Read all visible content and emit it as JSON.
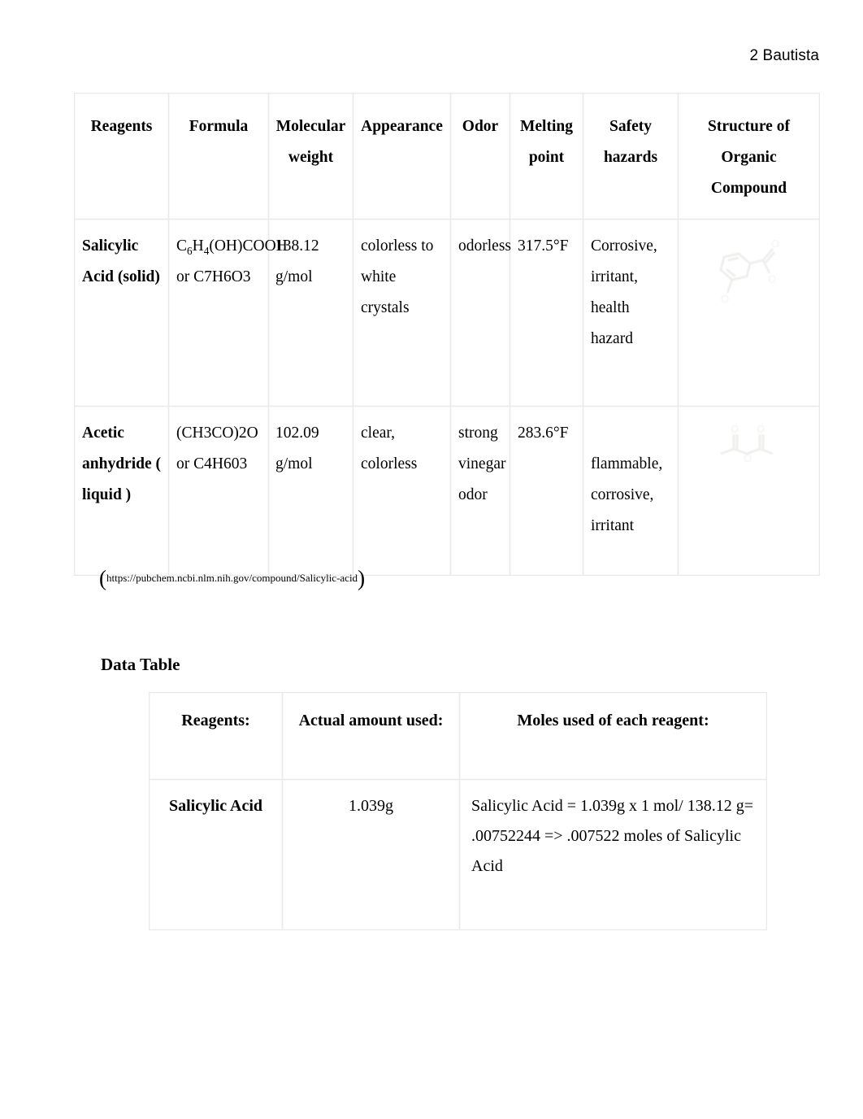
{
  "page": {
    "header": "2 Bautista"
  },
  "reagent_table": {
    "headers": [
      "Reagents",
      "Formula",
      "Molecular weight",
      "Appearance",
      "Odor",
      "Melting point",
      "Safety hazards",
      "Structure of Organic Compound"
    ],
    "rows": [
      {
        "reagent": "Salicylic Acid (solid)",
        "formula_main_prefix": "C",
        "formula_sub1": "6",
        "formula_mid": "H",
        "formula_sub2": "4",
        "formula_rest": "(OH)COOH or",
        "formula_alt": "C7H6O3",
        "molecular_weight": "138.12 g/mol",
        "appearance": "colorless to white crystals",
        "odor": "odorless",
        "melting_point": "317.5°F",
        "safety_hazards": "Corrosive, irritant, health hazard",
        "structure_alt": "salicylic-acid-skeletal-structure"
      },
      {
        "reagent": "Acetic anhydride ( liquid )",
        "formula": "(CH3CO)2O or",
        "formula_alt": "C4H603",
        "molecular_weight": "102.09 g/mol",
        "appearance": "clear, colorless",
        "odor": "strong vinegar odor",
        "melting_point": "283.6°F",
        "safety_hazards": "flammable, corrosive, irritant",
        "structure_alt": "acetic-anhydride-skeletal-structure"
      }
    ]
  },
  "source": {
    "open_paren": "(",
    "url": "https://pubchem.ncbi.nlm.nih.gov/compound/Salicylic-acid",
    "close_paren": ")"
  },
  "data_section": {
    "heading": "Data Table",
    "headers": [
      "Reagents:",
      "Actual amount used:",
      "Moles used of each reagent:"
    ],
    "rows": [
      {
        "reagent": "Salicylic Acid",
        "amount": "1.039g",
        "moles": "Salicylic Acid = 1.039g x 1 mol/ 138.12 g= .00752244 => .007522 moles of Salicylic Acid"
      }
    ]
  },
  "colors": {
    "text": "#000000",
    "page_background": "#ffffff",
    "table_border": "#e9e9e9"
  }
}
